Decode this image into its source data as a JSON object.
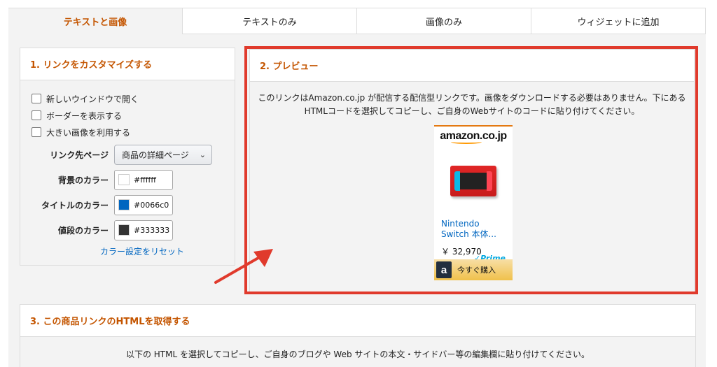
{
  "tabs": [
    {
      "label": "テキストと画像",
      "active": true
    },
    {
      "label": "テキストのみ",
      "active": false
    },
    {
      "label": "画像のみ",
      "active": false
    },
    {
      "label": "ウィジェットに追加",
      "active": false
    }
  ],
  "customize": {
    "title": "1. リンクをカスタマイズする",
    "checkboxes": [
      {
        "label": "新しいウインドウで開く",
        "checked": false
      },
      {
        "label": "ボーダーを表示する",
        "checked": false
      },
      {
        "label": "大きい画像を利用する",
        "checked": false
      }
    ],
    "link_target": {
      "label": "リンク先ページ",
      "value": "商品の詳細ページ"
    },
    "bg_color": {
      "label": "背景のカラー",
      "value": "#ffffff",
      "swatch": "#ffffff"
    },
    "title_color": {
      "label": "タイトルのカラー",
      "value": "#0066c0",
      "swatch": "#0066c0"
    },
    "price_color": {
      "label": "値段のカラー",
      "value": "#333333",
      "swatch": "#333333"
    },
    "reset_label": "カラー設定をリセット"
  },
  "preview": {
    "title": "2. プレビュー",
    "description": "このリンクはAmazon.co.jp が配信する配信型リンクです。画像をダウンロードする必要はありません。下にあるHTMLコードを選択してコピーし、ご自身のWebサイトのコードに貼り付けてください。",
    "ad": {
      "logo": "amazon.co.jp",
      "product_title": "Nintendo Switch 本体...",
      "price": "￥ 32,970",
      "prime": "✓Prime",
      "buy_icon": "a",
      "buy_label": "今すぐ購入"
    }
  },
  "get_html": {
    "title": "3. この商品リンクのHTMLを取得する",
    "description": "以下の HTML を選択してコピーし、ご自身のブログや Web サイトの本文・サイドバー等の編集欄に貼り付けてください。"
  },
  "colors": {
    "accent": "#c45500",
    "link": "#0066c0",
    "highlight_red": "#e03a2c"
  }
}
